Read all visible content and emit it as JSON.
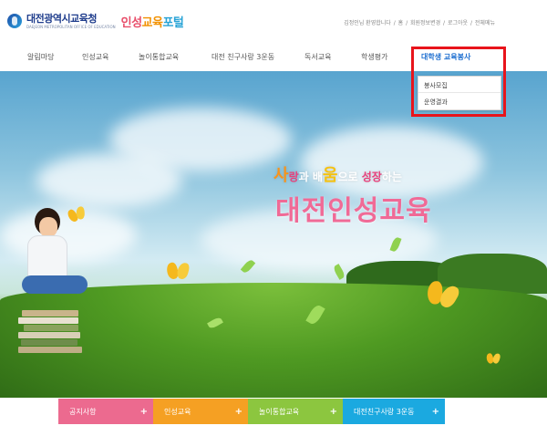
{
  "header": {
    "org_name": "대전광역시교육청",
    "org_name_en": "DAEJEON METROPOLITAN OFFICE OF EDUCATION",
    "portal_name_a": "인성",
    "portal_name_b": "교육",
    "portal_name_c": "포털",
    "util_links": [
      "김정인님 환영합니다",
      "홈",
      "회원정보변경",
      "로그아웃",
      "전체메뉴"
    ]
  },
  "nav": {
    "items": [
      "알림마당",
      "인성교육",
      "놀이통합교육",
      "대전 친구사랑 3운동",
      "독서교육",
      "학생평가",
      "대학생 교육봉사"
    ],
    "active_index": 6
  },
  "dropdown": {
    "items": [
      "봉사모집",
      "운영결과"
    ]
  },
  "hero": {
    "slogan_s1": "사",
    "slogan_s2": "랑",
    "slogan_s3": "과 배",
    "slogan_s4": "움",
    "slogan_s5": "으로 ",
    "slogan_s6": "성장",
    "slogan_s7": "하는",
    "slogan_main": "대전인성교육"
  },
  "quick_menu": [
    {
      "label": "공지사항",
      "color": "#ec6a8f"
    },
    {
      "label": "인성교육",
      "color": "#f5a023"
    },
    {
      "label": "놀이통합교육",
      "color": "#8cc63f"
    },
    {
      "label": "대전친구사랑 3운동",
      "color": "#1ba9e0"
    }
  ],
  "icons": {
    "quick_plus": "plus-icon",
    "logo": "education-office-logo-icon"
  },
  "colors": {
    "highlight": "#e8141b",
    "nav_active": "#1e6fd0"
  }
}
